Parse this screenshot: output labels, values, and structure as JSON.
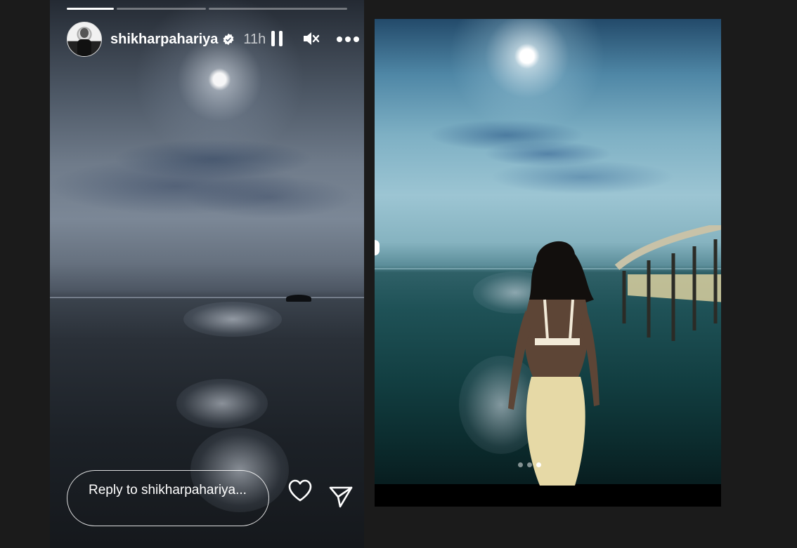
{
  "story": {
    "username": "shikharpahariya",
    "verified": true,
    "time_ago": "11h",
    "progress": [
      {
        "fill": 1.0
      },
      {
        "fill": 0.0
      },
      {
        "fill": 0.0
      }
    ],
    "controls": {
      "pause_icon": "pause-icon",
      "mute_icon": "speaker-muted-icon",
      "more_icon": "more-horizontal-icon"
    },
    "reply_placeholder": "Reply to shikharpahariya...",
    "like_icon": "heart-outline-icon",
    "share_icon": "paper-plane-icon"
  },
  "preview": {
    "carousel": {
      "count": 3,
      "active_index": 2
    }
  }
}
